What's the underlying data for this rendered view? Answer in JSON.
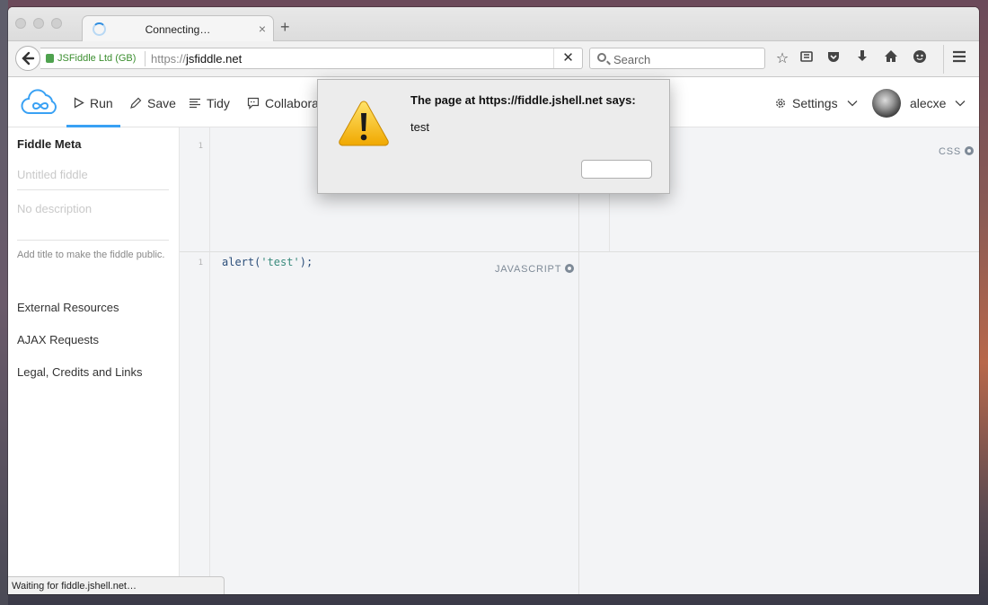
{
  "browser": {
    "tab": {
      "title": "Connecting…",
      "close": "×"
    },
    "new_tab": "+",
    "url": {
      "site_identity": "JSFiddle Ltd (GB)",
      "scheme": "https://",
      "host": "jsfiddle.net",
      "stop": "✕"
    },
    "search": {
      "placeholder": "Search"
    },
    "status_text": "Waiting for fiddle.jshell.net…"
  },
  "header": {
    "run_label": "Run",
    "save_label": "Save",
    "tidy_label": "Tidy",
    "collaborate_label": "Collaborat",
    "settings_label": "Settings",
    "user_name": "alecxe"
  },
  "sidebar": {
    "title": "Fiddle Meta",
    "title_placeholder": "Untitled fiddle",
    "description_placeholder": "No description",
    "hint": "Add title to make the fiddle public.",
    "links": [
      "External Resources",
      "AJAX Requests",
      "Legal, Credits and Links"
    ]
  },
  "editors": {
    "html_line": "1",
    "css_label": "CSS",
    "js_line": "1",
    "js_label": "JAVASCRIPT",
    "js_code_fn": "alert(",
    "js_code_str": "'test'",
    "js_code_end": ");"
  },
  "dialog": {
    "title": "The page at https://fiddle.jshell.net says:",
    "message": "test",
    "ok_label": ""
  },
  "colors": {
    "accent": "#39a1f4",
    "secure_green": "#3b8e2f"
  }
}
